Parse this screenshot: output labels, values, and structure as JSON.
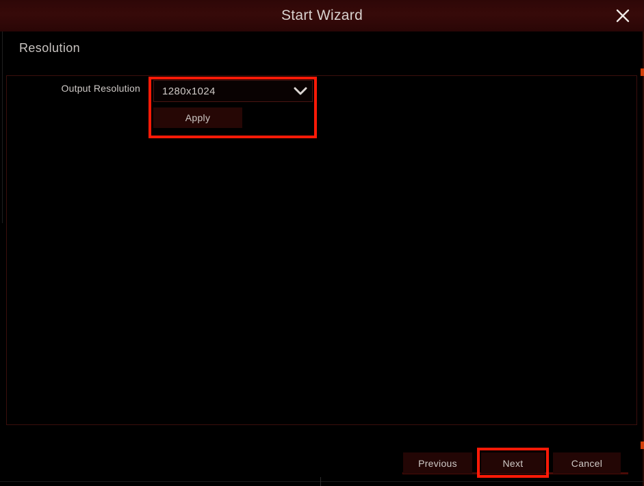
{
  "window": {
    "title": "Start Wizard",
    "close_icon": "close-x-icon"
  },
  "section": {
    "title": "Resolution"
  },
  "form": {
    "output_resolution": {
      "label": "Output Resolution",
      "value": "1280x1024",
      "chevron_icon": "chevron-down-icon"
    },
    "apply_label": "Apply"
  },
  "footer": {
    "previous_label": "Previous",
    "next_label": "Next",
    "cancel_label": "Cancel"
  },
  "annotations": {
    "highlight_color": "#ff1a07",
    "targets": [
      "output-resolution-group",
      "next-button"
    ]
  },
  "colors": {
    "titlebar": "#2e0707",
    "panel_border": "#3b0f0c",
    "button_face": "#230605",
    "text": "#cfcac7",
    "background": "#000000"
  }
}
